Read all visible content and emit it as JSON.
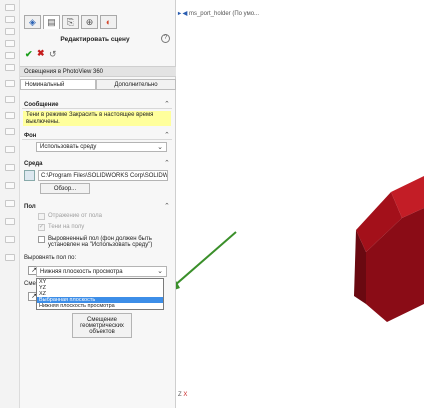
{
  "colors": {
    "accept": "#1b9e1b",
    "cancel": "#c51c1c",
    "message_bg": "#ffff9c",
    "selected_option": "#3d8ee8",
    "model": "#a3101a",
    "arrow": "#3a8f2a"
  },
  "tabs": [
    {
      "icon": "feature-manager-icon"
    },
    {
      "icon": "property-manager-icon"
    },
    {
      "icon": "configuration-manager-icon"
    },
    {
      "icon": "dimxpert-icon"
    },
    {
      "icon": "display-manager-icon"
    }
  ],
  "panel": {
    "title": "Редактировать сцену",
    "help": "?",
    "accept": "✔",
    "cancel": "✖",
    "undo": "↺",
    "photoview_label": "Освещения в PhotoView 360",
    "tab_basic": "Номинальный",
    "tab_advanced": "Дополнительно"
  },
  "message": {
    "header": "Сообщение",
    "text": "Тени в режиме Закрасить в настоящее время выключены."
  },
  "background": {
    "header": "Фон",
    "value": "Использовать среду"
  },
  "environment": {
    "header": "Среда",
    "path": "C:\\Program Files\\SOLIDWORKS Corp\\SOLIDWORKS",
    "browse": "Обзор..."
  },
  "floor": {
    "header": "Пол",
    "reflection": "Отражение от пола",
    "shadows": "Тени на полу",
    "aligned_floor": "Выровненный пол (фон должен быть установлен на \"Использовать среду\")",
    "align_label": "Выровнять пол по:",
    "align_value": "Нижняя плоскость просмотра",
    "options": [
      "XY",
      "YZ",
      "XZ",
      "Выбранная плоскость",
      "Нижняя плоскость просмотра"
    ],
    "selected_index": 3,
    "offset_label": "Смещ",
    "offset_button": "Смещение геометрических объектов"
  },
  "view": {
    "crumb_text": "ms_port_holder (По умо..."
  }
}
